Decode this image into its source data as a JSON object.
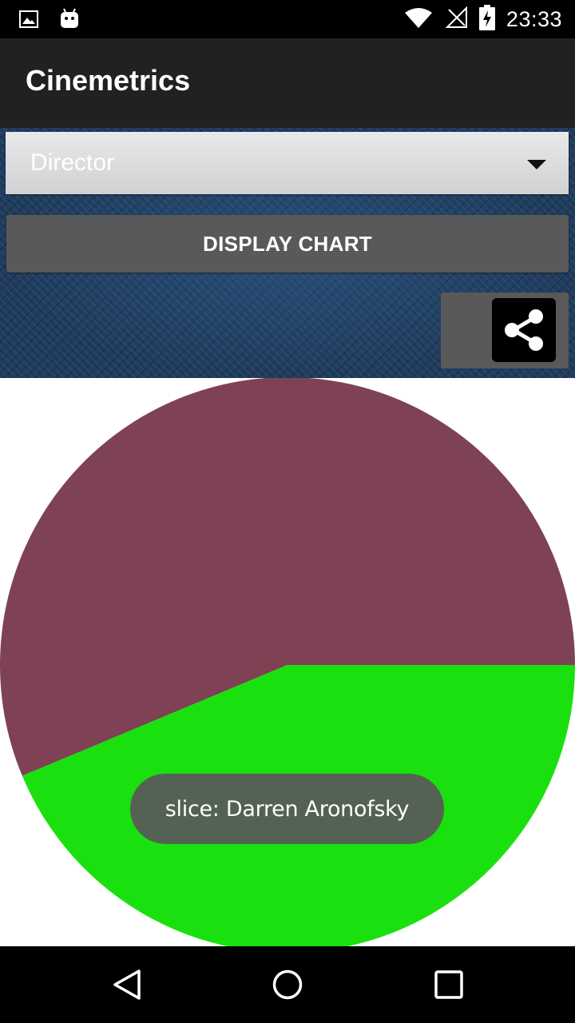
{
  "status_bar": {
    "time": "23:33",
    "icons": [
      "image-icon",
      "android-icon",
      "wifi-icon",
      "no-signal-icon",
      "battery-charging-icon"
    ]
  },
  "app": {
    "title": "Cinemetrics"
  },
  "controls": {
    "spinner_value": "Director",
    "display_button_label": "DISPLAY CHART",
    "share_icon": "share-icon"
  },
  "chart_data": {
    "type": "pie",
    "series": [
      {
        "label": "",
        "value": 56.3,
        "color": "#7e4254"
      },
      {
        "label": "Darren Aronofsky",
        "value": 43.7,
        "color": "#1ae00f"
      }
    ]
  },
  "toast": {
    "text": "slice: Darren Aronofsky"
  },
  "nav_bar": {
    "icons": [
      "back-icon",
      "home-icon",
      "recents-icon"
    ]
  }
}
